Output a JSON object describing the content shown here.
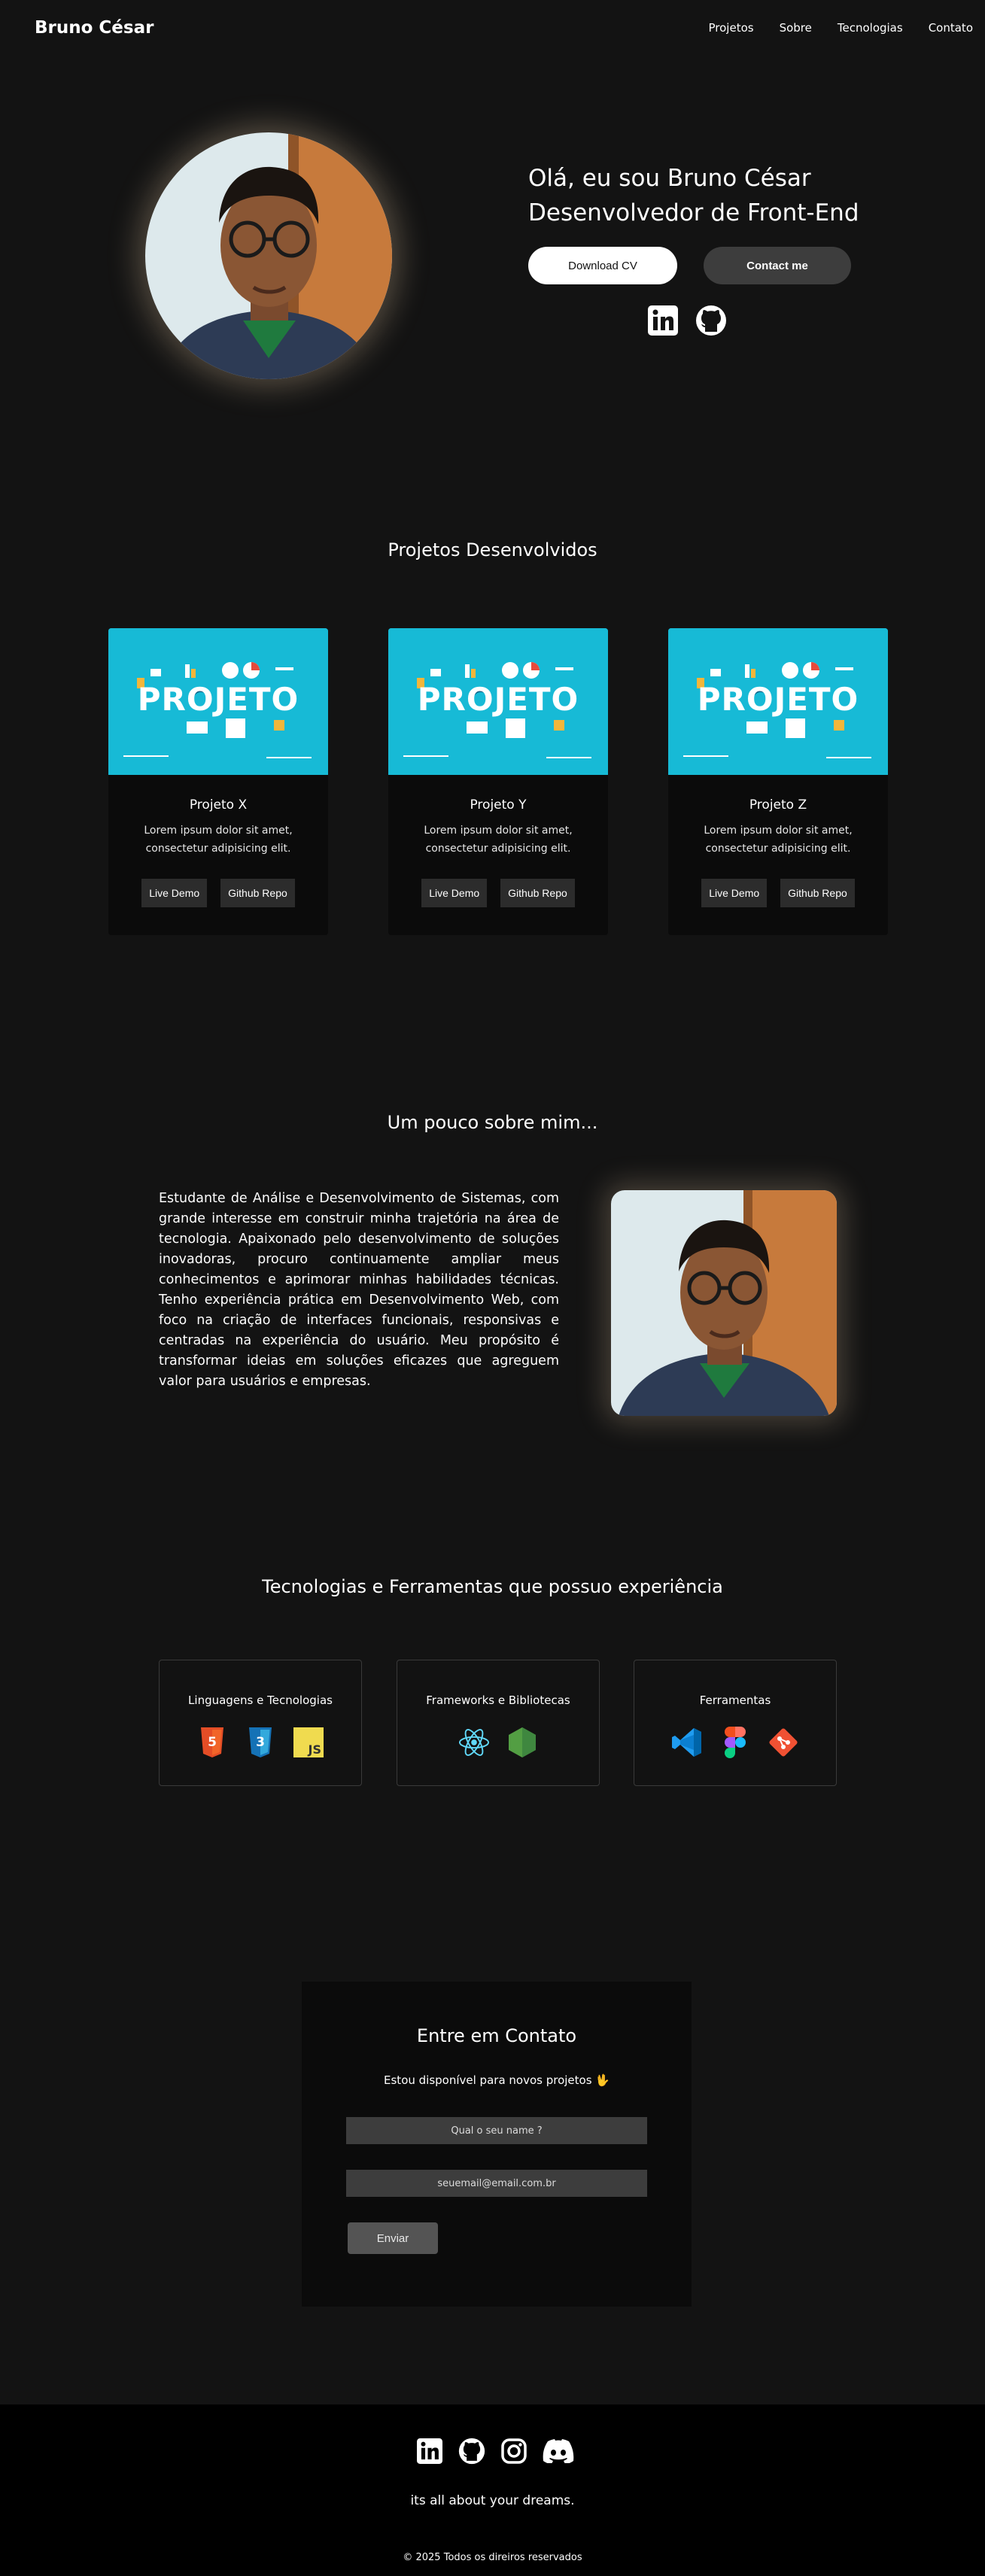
{
  "nav": {
    "brand": "Bruno César",
    "links": [
      "Projetos",
      "Sobre",
      "Tecnologias",
      "Contato"
    ]
  },
  "hero": {
    "line1": "Olá, eu sou Bruno César",
    "line2": "Desenvolvedor de Front-End",
    "download_label": "Download CV",
    "contact_label": "Contact me",
    "social_icons": [
      "linkedin-icon",
      "github-icon"
    ]
  },
  "projects": {
    "title": "Projetos Desenvolvidos",
    "items": [
      {
        "image_text": "PROJETO",
        "name": "Projeto X",
        "desc": "Lorem ipsum dolor sit amet, consectetur adipisicing elit.",
        "demo": "Live Demo",
        "repo": "Github Repo"
      },
      {
        "image_text": "PROJETO",
        "name": "Projeto Y",
        "desc": "Lorem ipsum dolor sit amet, consectetur adipisicing elit.",
        "demo": "Live Demo",
        "repo": "Github Repo"
      },
      {
        "image_text": "PROJETO",
        "name": "Projeto Z",
        "desc": "Lorem ipsum dolor sit amet, consectetur adipisicing elit.",
        "demo": "Live Demo",
        "repo": "Github Repo"
      }
    ]
  },
  "about": {
    "title": "Um pouco sobre mim...",
    "text": "Estudante de Análise e Desenvolvimento de Sistemas, com grande interesse em construir minha trajetória na área de tecnologia. Apaixonado pelo desenvolvimento de soluções inovadoras, procuro continuamente ampliar meus conhecimentos e aprimorar minhas habilidades técnicas. Tenho experiência prática em Desenvolvimento Web, com foco na criação de interfaces funcionais, responsivas e centradas na experiência do usuário. Meu propósito é transformar ideias em soluções eficazes que agreguem valor para usuários e empresas."
  },
  "tech": {
    "title": "Tecnologias e Ferramentas que possuo experiência",
    "groups": [
      {
        "title": "Linguagens e Tecnologias",
        "icons": [
          "html5-icon",
          "css3-icon",
          "javascript-icon"
        ],
        "labels": [
          "5",
          "3",
          "JS"
        ]
      },
      {
        "title": "Frameworks e Bibliotecas",
        "icons": [
          "react-icon",
          "nodejs-icon"
        ]
      },
      {
        "title": "Ferramentas",
        "icons": [
          "vscode-icon",
          "figma-icon",
          "git-icon"
        ]
      }
    ]
  },
  "contact": {
    "title": "Entre em Contato",
    "subtitle": "Estou disponível para novos projetos 🖖",
    "name_placeholder": "Qual o seu name ?",
    "email_placeholder": "seuemail@email.com.br",
    "send_label": "Enviar"
  },
  "footer": {
    "social_icons": [
      "linkedin-icon",
      "github-icon",
      "instagram-icon",
      "discord-icon"
    ],
    "tagline": "its all about your dreams.",
    "copyright": "© 2025 Todos os direiros reservados"
  },
  "colors": {
    "background": "#131313",
    "card": "#0b0b0b",
    "project_image": "#17bad6",
    "footer": "#000000"
  }
}
